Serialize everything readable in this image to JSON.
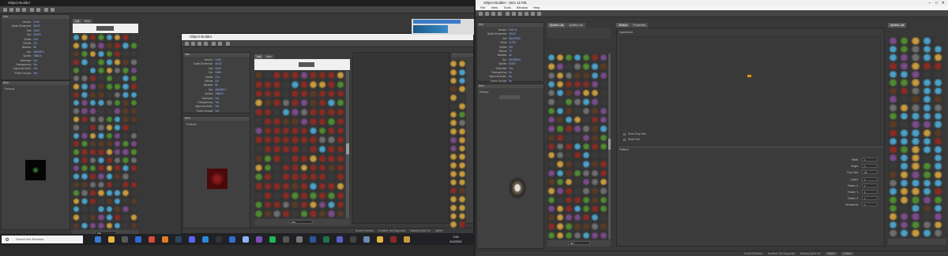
{
  "left": {
    "title": "Object Builder",
    "info_header": "Info",
    "info": [
      {
        "k": "Version:",
        "v": "10.80"
      },
      {
        "k": "Sprite Dimension:",
        "v": "32x32"
      },
      {
        "k": "Dat:",
        "v": "4DA2"
      },
      {
        "k": "Spr:",
        "v": "3A0E8"
      },
      {
        "k": "Outfits:",
        "v": "1111"
      },
      {
        "k": "Effects:",
        "v": "110"
      },
      {
        "k": "Missiles:",
        "v": "58"
      },
      {
        "k": "Spr:",
        "v": "3DB4BC1"
      },
      {
        "k": "Sprites:",
        "v": "788820"
      },
      {
        "k": "Extended:",
        "v": "Yes"
      },
      {
        "k": "Transparency:",
        "v": "Yes"
      },
      {
        "k": "Improved Anim.:",
        "v": "Yes"
      },
      {
        "k": "Frame Groups:",
        "v": "Yes"
      }
    ],
    "tabs": [
      "Lot",
      "Item"
    ],
    "preview_header": "Item",
    "preview_label": "Previous",
    "page_field": "160",
    "status": [
      "Sound Selection",
      "Enabled: Not Supported",
      "Missing Sprite 5.5"
    ]
  },
  "dialog": {
    "title": "Object Builder",
    "info_header": "Info",
    "info": [
      {
        "k": "Version:",
        "v": "10.80"
      },
      {
        "k": "Sprite Dimension:",
        "v": "32x32"
      },
      {
        "k": "Dat:",
        "v": "4DA0"
      },
      {
        "k": "Spr:",
        "v": "3DB5"
      },
      {
        "k": "Outfits:",
        "v": "1111"
      },
      {
        "k": "Effects:",
        "v": "110"
      },
      {
        "k": "Missiles:",
        "v": "58"
      },
      {
        "k": "Spr:",
        "v": "3DB4BC1"
      },
      {
        "k": "Sprites:",
        "v": "788820"
      },
      {
        "k": "Extended:",
        "v": "Yes"
      },
      {
        "k": "Transparency:",
        "v": "Yes"
      },
      {
        "k": "Improved Anim.:",
        "v": "Yes"
      },
      {
        "k": "Frame Groups:",
        "v": "Yes"
      }
    ],
    "tabs": [
      "Lot",
      "Item"
    ],
    "preview_header": "Item",
    "preview_label": "Previous",
    "page_field": "160",
    "status": [
      "Sound Selection",
      "Enabled: Not Supported",
      "Missing Sprite 5.5",
      "Sprites"
    ]
  },
  "right": {
    "title": "Object Builder - Item 11708",
    "menu": [
      "File",
      "View",
      "Tools",
      "Window",
      "Help"
    ],
    "info_header": "Info",
    "info": [
      {
        "k": "Version:",
        "v": "8.60 v3"
      },
      {
        "k": "Sprite Dimension:",
        "v": "32x32"
      },
      {
        "k": "Dat:",
        "v": "5D637552"
      },
      {
        "k": "Items:",
        "v": "11709"
      },
      {
        "k": "Outfits:",
        "v": "367"
      },
      {
        "k": "Effects:",
        "v": "70"
      },
      {
        "k": "Missiles:",
        "v": "40"
      },
      {
        "k": "Spr:",
        "v": "8D258394"
      },
      {
        "k": "Sprites:",
        "v": "40492"
      },
      {
        "k": "Extended:",
        "v": "Yes"
      },
      {
        "k": "Transparency:",
        "v": "No"
      },
      {
        "k": "Improved Anim.:",
        "v": "No"
      },
      {
        "k": "Frame Groups:",
        "v": "No"
      }
    ],
    "item_header": "Item",
    "preview_label": "Preview",
    "grid_tabs": [
      "Sprites List",
      "Sprites List"
    ],
    "editor_tabs": [
      "Texture",
      "Properties"
    ],
    "appearance_label": "Appearance",
    "checkboxes": [
      "Show Crop Size",
      "Show Grid"
    ],
    "patterns_header": "Patterns",
    "pattern_fields": [
      {
        "k": "Width:",
        "v": "1"
      },
      {
        "k": "Height:",
        "v": "1"
      },
      {
        "k": "Crop Size:",
        "v": "32"
      },
      {
        "k": "Layers:",
        "v": "1"
      },
      {
        "k": "Pattern X:",
        "v": "1"
      },
      {
        "k": "Pattern Y:",
        "v": "1"
      },
      {
        "k": "Pattern Z:",
        "v": "1"
      },
      {
        "k": "Animations:",
        "v": "1"
      }
    ],
    "page_field": "567",
    "right_tabs": [
      "Sprites List"
    ],
    "status": [
      "Sound Selection",
      "Enabled: Not Supported",
      "Missing Sprite 5.5",
      "Save",
      "Close"
    ]
  },
  "taskbar": {
    "search_placeholder": "Search this Windows",
    "time": "2:06",
    "date": "4/12/2021"
  },
  "colors": {
    "accent_blue": "#8fb3ff",
    "item_red": "#8b2a22",
    "item_green": "#4e8b2e",
    "item_gray": "#6e6e6e",
    "item_ice": "#4aa0c8",
    "item_gold": "#c89a3c"
  }
}
